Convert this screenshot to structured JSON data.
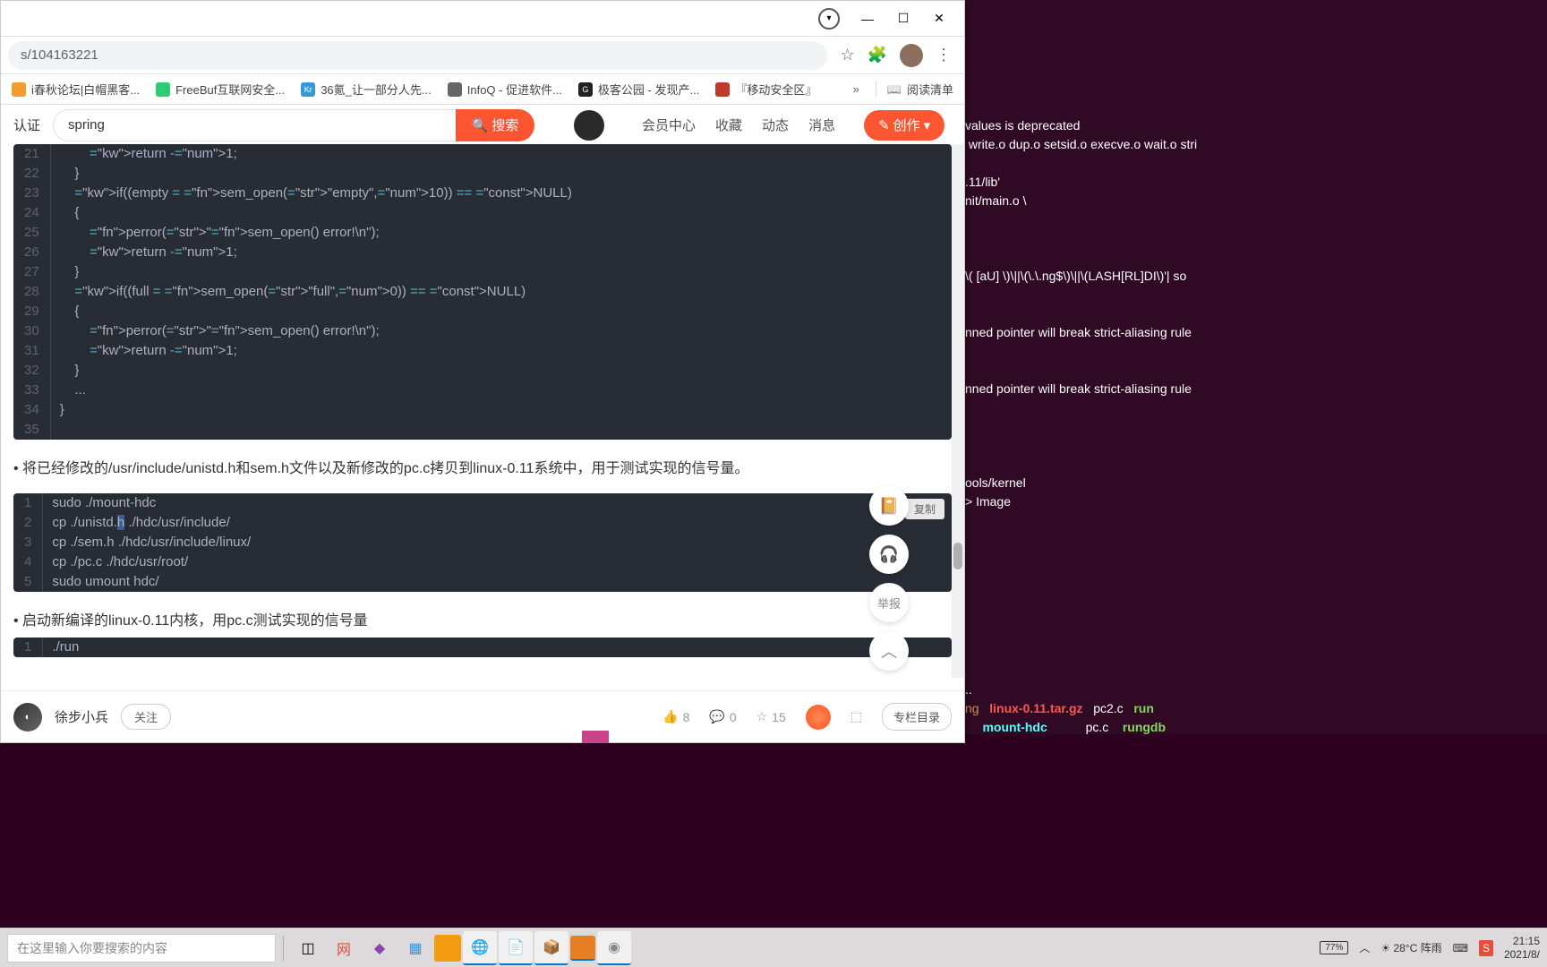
{
  "browser": {
    "url": "s/104163221",
    "title_buttons": {
      "min": "—",
      "max": "☐",
      "close": "✕"
    }
  },
  "bookmarks": [
    {
      "icon": "#f39c2c",
      "label": "i春秋论坛|白帽黑客..."
    },
    {
      "icon": "#2ecc71",
      "label": "FreeBuf互联网安全..."
    },
    {
      "icon": "#3498db",
      "label": "36氪_让一部分人先..."
    },
    {
      "icon": "#666666",
      "label": "InfoQ - 促进软件..."
    },
    {
      "icon": "#222222",
      "label": "极客公园 - 发现产..."
    },
    {
      "icon": "#c0392b",
      "label": "『移动安全区』"
    }
  ],
  "bookmark_more": "»",
  "reading_list": "阅读清单",
  "site": {
    "cert": "认证",
    "search_value": "spring",
    "search_placeholder": "搜索",
    "search_btn": "搜索",
    "nav": {
      "member": "会员中心",
      "favorite": "收藏",
      "dynamic": "动态",
      "message": "消息"
    },
    "create": "创作"
  },
  "code1": {
    "start": 21,
    "lines": [
      "        return -1;",
      "    }",
      "    if((empty = sem_open(\"empty\",10)) == NULL)",
      "    {",
      "        perror(\"sem_open() error!\\n\");",
      "        return -1;",
      "    }",
      "    if((full = sem_open(\"full\",0)) == NULL)",
      "    {",
      "        perror(\"sem_open() error!\\n\");",
      "        return -1;",
      "    }",
      "    ...",
      "}",
      ""
    ]
  },
  "article1": "将已经修改的/usr/include/unistd.h和sem.h文件以及新修改的pc.c拷贝到linux-0.11系统中，用于测试实现的信号量。",
  "code2": {
    "copy": "复制",
    "lines": [
      "sudo ./mount-hdc",
      "cp ./unistd.h ./hdc/usr/include/",
      "cp ./sem.h ./hdc/usr/include/linux/",
      "cp ./pc.c ./hdc/usr/root/",
      "sudo umount hdc/"
    ]
  },
  "article2": "启动新编译的linux-0.11内核，用pc.c测试实现的信号量",
  "code3_line": "./run",
  "floats": {
    "notes": "📔",
    "headset": "🎧",
    "report": "举报",
    "top": "︿"
  },
  "footer": {
    "author": "徐步小兵",
    "follow": "关注",
    "like": "8",
    "comment": "0",
    "star": "15",
    "column": "专栏目录"
  },
  "terminal": {
    "l1": "values is deprecated",
    "l2": " write.o dup.o setsid.o execve.o wait.o stri",
    "l3": ".11/lib'",
    "l4": "nit/main.o \\",
    "l5": "\\( [aU] \\)\\||\\(\\.\\.ng$\\)\\||\\(LASH[RL]DI\\)'| so",
    "l6": "nned pointer will break strict-aliasing rule",
    "l7": "nned pointer will break strict-aliasing rule",
    "l8": "ools/kernel",
    "l9": "> Image",
    "l10": "..",
    "files1a": "ng",
    "files1b": "linux-0.11.tar.gz",
    "files1c": "pc2.c",
    "files1d": "run",
    "files2a": "",
    "files2b": "mount-hdc",
    "files2c": "pc.c",
    "files2d": "rungdb"
  },
  "taskbar": {
    "search_placeholder": "在这里输入你要搜索的内容",
    "weather": "28°C 阵雨",
    "battery": "77%",
    "time": "21:15",
    "date": "2021/8/"
  }
}
